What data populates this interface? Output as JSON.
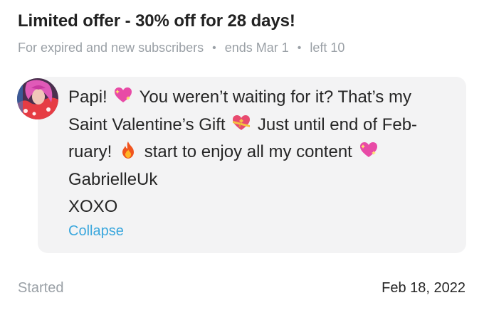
{
  "offer": {
    "title": "Limited offer - 30% off for 28 days!",
    "audience": "For expired and new subscribers",
    "ends": "ends Mar 1",
    "left": "left 10",
    "separator": "•"
  },
  "message": {
    "line1_a": "Papi!",
    "line1_b": "You weren’t waiting for it? That’s my",
    "line2_a": "Saint Valentine’s Gift",
    "line2_b": "Just until end of Feb-",
    "line3_a": "ruary!",
    "line3_b": "start to enjoy all my content",
    "line4": "GabrielleUk",
    "line5": "XOXO",
    "emojis": [
      "sparkling-heart-icon",
      "heart-with-ribbon-icon",
      "fire-icon",
      "sparkling-heart-icon"
    ]
  },
  "actions": {
    "collapse_label": "Collapse"
  },
  "footer": {
    "started_label": "Started",
    "started_date": "Feb 18, 2022"
  },
  "colors": {
    "link": "#3aa7dd",
    "muted": "#9aa0a6",
    "bubble": "#f3f3f4"
  }
}
